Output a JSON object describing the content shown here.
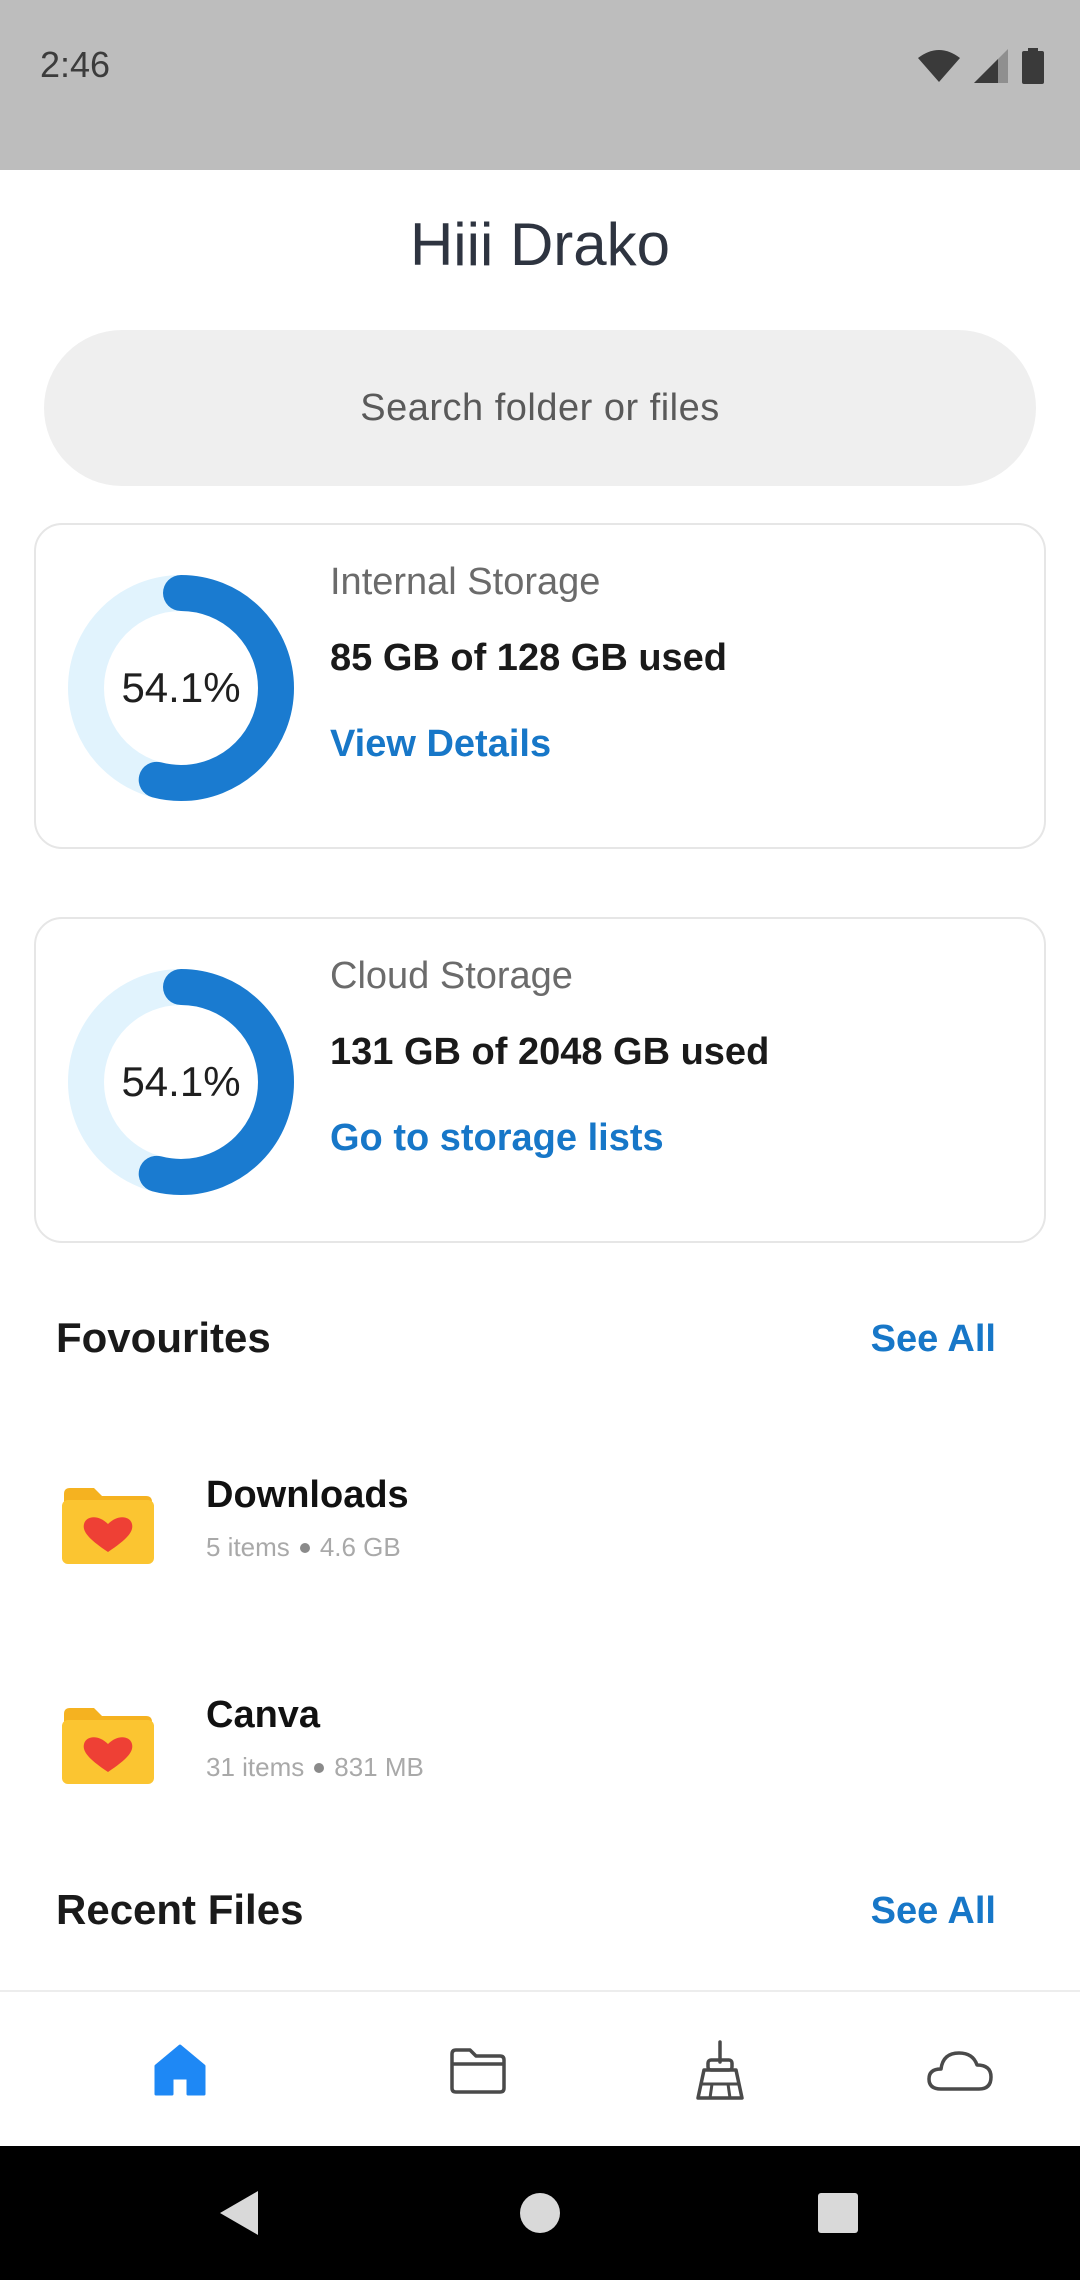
{
  "status_bar": {
    "time": "2:46"
  },
  "greeting": "Hiii Drako",
  "search": {
    "placeholder": "Search folder or files"
  },
  "storage_cards": [
    {
      "title": "Internal Storage",
      "percent_label": "54.1%",
      "percent_value": 54.1,
      "usage": "85 GB of 128 GB used",
      "link": "View Details"
    },
    {
      "title": "Cloud Storage",
      "percent_label": "54.1%",
      "percent_value": 54.1,
      "usage": "131 GB of 2048 GB used",
      "link": "Go to storage lists"
    }
  ],
  "favourites": {
    "title": "Fovourites",
    "see_all": "See All",
    "items": [
      {
        "name": "Downloads",
        "count": "5 items",
        "size": "4.6 GB"
      },
      {
        "name": "Canva",
        "count": "31 items",
        "size": "831 MB"
      }
    ]
  },
  "recent": {
    "title": "Recent Files",
    "see_all": "See All"
  },
  "bottom_nav": [
    {
      "icon": "home-icon",
      "active": true
    },
    {
      "icon": "folder-icon",
      "active": false
    },
    {
      "icon": "broom-icon",
      "active": false
    },
    {
      "icon": "cloud-icon",
      "active": false
    }
  ],
  "colors": {
    "accent": "#1777c8",
    "donut_track": "#e1f3fd",
    "donut_fill": "#1a7bd0",
    "folder": "#fbc531",
    "heart": "#ee4035",
    "home_active": "#1e88f5"
  }
}
